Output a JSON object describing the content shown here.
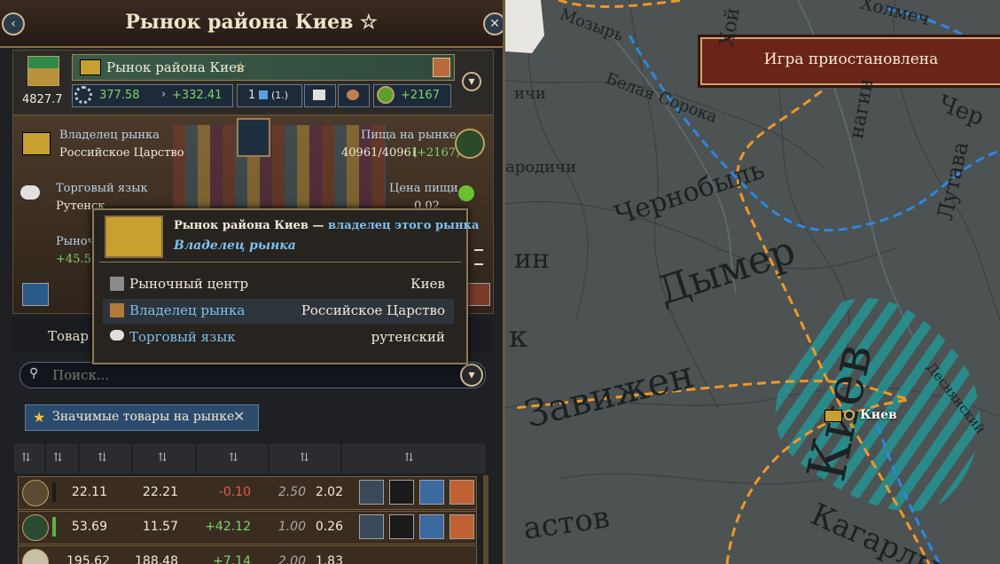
{
  "header": {
    "title": "Рынок района Киев ☆",
    "back_icon": "‹",
    "close_icon": "✕"
  },
  "market_info": {
    "name": "Рынок района Киев",
    "gold": "4827.7",
    "production": "377.58",
    "income": "+332.41",
    "count": "1",
    "count_sub": "(1.)",
    "food_income": "+2167"
  },
  "scene": {
    "owner_label": "Владелец рынка",
    "owner_value": "Российское Царство",
    "food_label": "Пища на рынке",
    "food_value": "40961/40961",
    "food_delta": "(+2167)",
    "language_label": "Торговый язык",
    "language_value": "Рутенск",
    "food_price_label": "Цена пищи",
    "food_price_value": "0.02",
    "market_short_label": "Рыноч",
    "market_short_value": "+45.56"
  },
  "tooltip": {
    "title_main": "Рынок района Киев —",
    "title_accent": "владелец этого рынка",
    "subtitle": "Владелец рынка",
    "rows": [
      {
        "label": "Рыночный центр",
        "value": "Киев"
      },
      {
        "label": "Владелец рынка",
        "value": "Российское Царство"
      },
      {
        "label": "Торговый язык",
        "value": "рутенский"
      }
    ]
  },
  "tabs": {
    "goods_label": "Товар"
  },
  "search": {
    "placeholder": "Поиск..."
  },
  "filter_chip": {
    "label": "Значимые товары на рынке"
  },
  "goods_rows": [
    {
      "supply": "22.11",
      "demand": "22.21",
      "balance": "-0.10",
      "base_price": "2.50",
      "price": "2.02"
    },
    {
      "supply": "53.69",
      "demand": "11.57",
      "balance": "+42.12",
      "base_price": "1.00",
      "price": "0.26"
    },
    {
      "supply": "195.62",
      "demand": "188.48",
      "balance": "+7.14",
      "base_price": "2.00",
      "price": "1.83"
    }
  ],
  "map": {
    "paused_label": "Игра приостановлена",
    "city_label": "Киев",
    "labels": {
      "dymer": "Дымер",
      "zavizhen": "Завижен",
      "kiev_region": "Киев",
      "chernobyl": "Чернобыль",
      "belaya_soroka": "Белая Сорока",
      "mozyr": "Мозырь",
      "lutava": "Лутава",
      "chi": "ичи",
      "darodichi": "ародичи",
      "in": "ин",
      "k": "к",
      "stov": "астов",
      "kag": "Кагарлы",
      "desninsky": "Деснянский",
      "hoy": "Хой",
      "holmech": "Холмеч",
      "chern": "Чер",
      "nagin": "нагин"
    }
  },
  "colors": {
    "positive": "#7ed36a",
    "negative": "#e05a4a",
    "accent_blue": "#7ec0f0",
    "route_orange": "#f0962a",
    "route_blue": "#2f86e0"
  }
}
